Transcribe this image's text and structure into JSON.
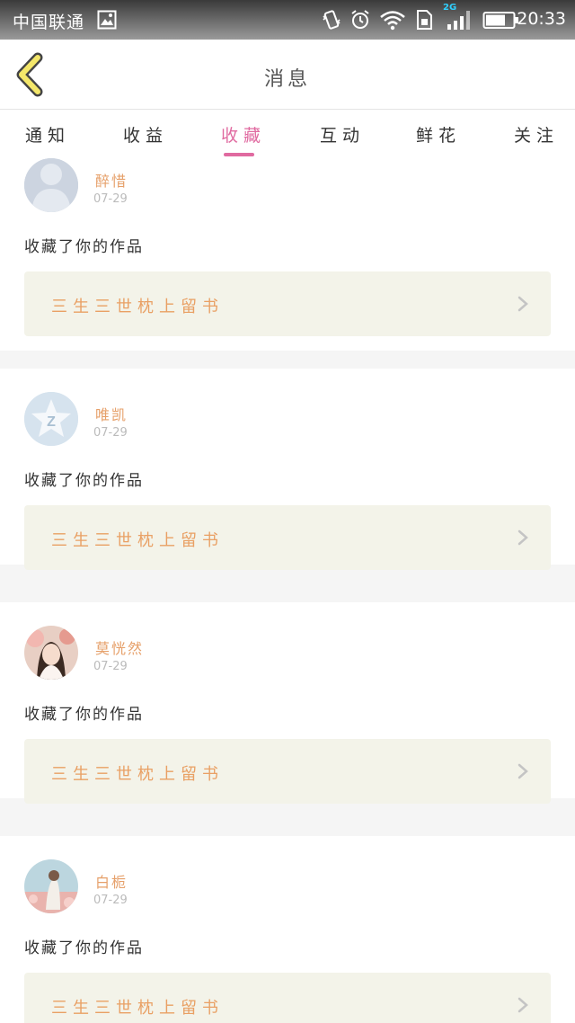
{
  "status_bar": {
    "carrier": "中国联通",
    "network_badge": "2G",
    "time": "20:33",
    "icons": [
      "image-icon",
      "vibrate-icon",
      "alarm-icon",
      "wifi-icon",
      "sim-icon",
      "signal-icon",
      "battery-icon"
    ]
  },
  "header": {
    "back_icon": "chevron-left-icon",
    "title": "消息"
  },
  "tabs": [
    {
      "label": "通知",
      "active": false
    },
    {
      "label": "收益",
      "active": false
    },
    {
      "label": "收藏",
      "active": true
    },
    {
      "label": "互动",
      "active": false
    },
    {
      "label": "鲜花",
      "active": false
    },
    {
      "label": "关注",
      "active": false
    }
  ],
  "colors": {
    "accent": "#e06aa0",
    "username": "#e6a06a",
    "work_title": "#e9a064",
    "work_box": "#f3f3e9"
  },
  "notifications": [
    {
      "username": "醉惜",
      "date": "07-29",
      "action": "收藏了你的作品",
      "work_title": "三生三世枕上留书",
      "avatar": "default-person-avatar"
    },
    {
      "username": "唯凯",
      "date": "07-29",
      "action": "收藏了你的作品",
      "work_title": "三生三世枕上留书",
      "avatar": "qq-star-avatar"
    },
    {
      "username": "莫恍然",
      "date": "07-29",
      "action": "收藏了你的作品",
      "work_title": "三生三世枕上留书",
      "avatar": "photo-avatar-girl"
    },
    {
      "username": "白栀",
      "date": "07-29",
      "action": "收藏了你的作品",
      "work_title": "三生三世枕上留书",
      "avatar": "photo-avatar-flowers"
    }
  ]
}
